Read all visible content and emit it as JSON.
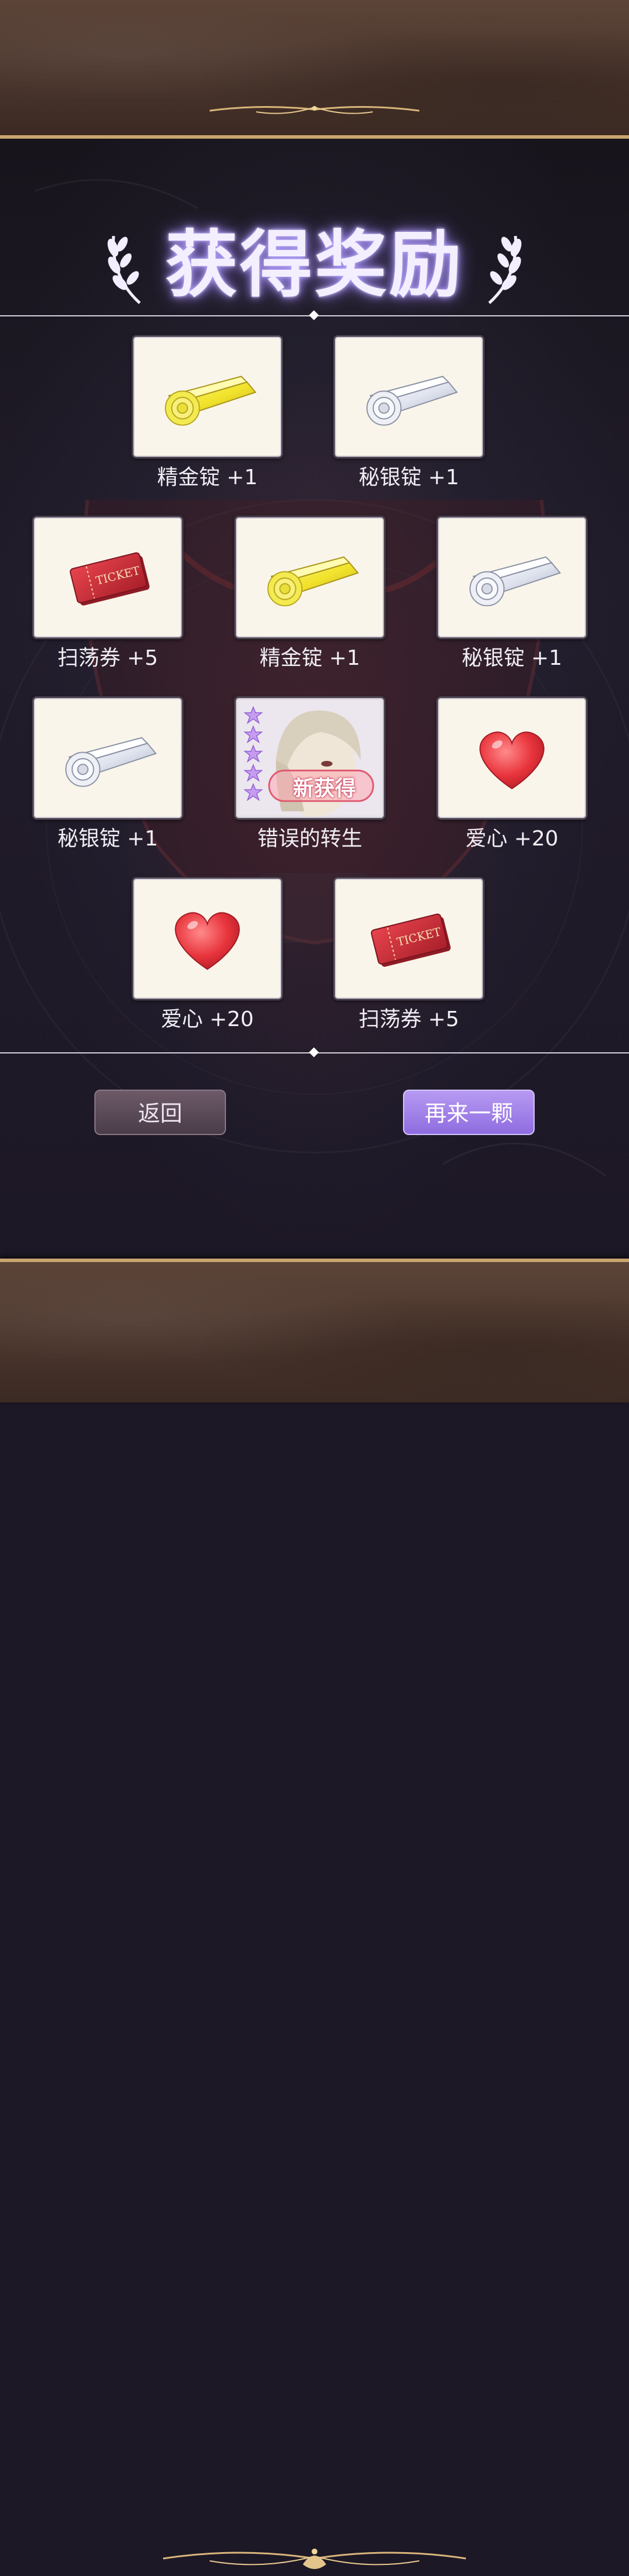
{
  "title": "获得奖励",
  "rewards": [
    {
      "name": "精金锭 +1",
      "icon": "gold-ingot-icon"
    },
    {
      "name": "秘银锭 +1",
      "icon": "mithril-ingot-icon"
    },
    {
      "name": "扫荡券 +5",
      "icon": "sweep-ticket-icon"
    },
    {
      "name": "精金锭 +1",
      "icon": "gold-ingot-icon"
    },
    {
      "name": "秘银锭 +1",
      "icon": "mithril-ingot-icon"
    },
    {
      "name": "秘银锭 +1",
      "icon": "mithril-ingot-icon"
    },
    {
      "name": "错误的转生",
      "icon": "character-card-icon",
      "badge": "新获得",
      "stars": 5
    },
    {
      "name": "爱心 +20",
      "icon": "heart-icon"
    },
    {
      "name": "爱心 +20",
      "icon": "heart-icon"
    },
    {
      "name": "扫荡券 +5",
      "icon": "sweep-ticket-icon"
    }
  ],
  "ticket_text": "TICKET",
  "buttons": {
    "back": "返回",
    "again": "再来一颗"
  },
  "colors": {
    "accent": "#9a7ae6",
    "frame": "#4a352c",
    "gold_trim": "#c9a56e"
  }
}
